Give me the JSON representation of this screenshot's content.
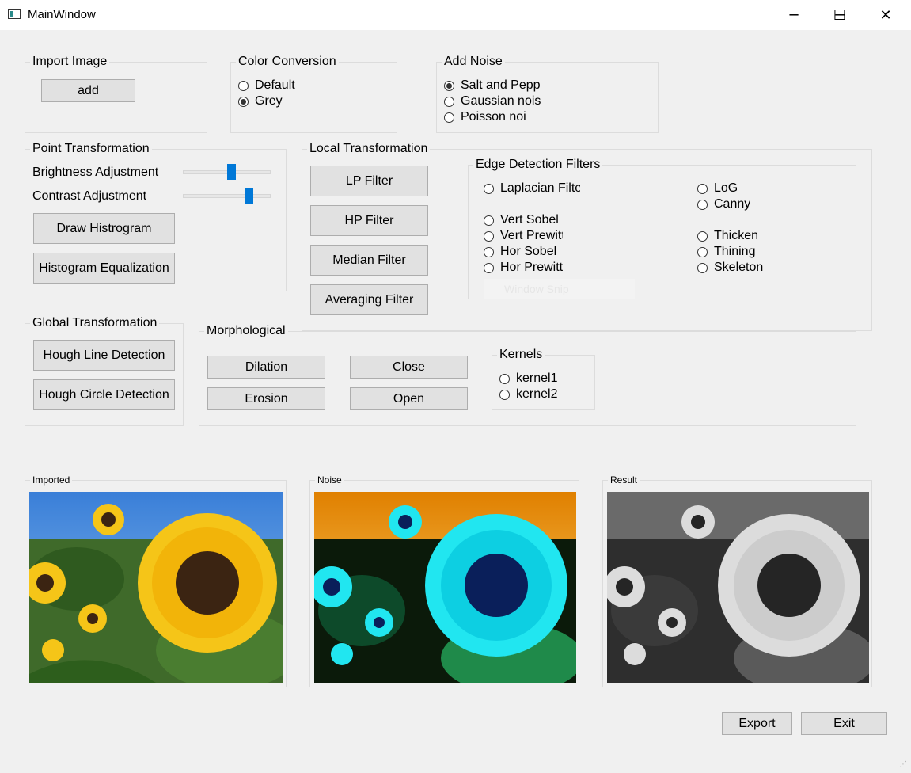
{
  "window": {
    "title": "MainWindow",
    "minimize_glyph": "─",
    "maximize_glyph": "☐",
    "close_glyph": "✕"
  },
  "import": {
    "title": "Import Image",
    "add_label": "add"
  },
  "color": {
    "title": "Color Conversion",
    "options": [
      "Default",
      "Grey"
    ],
    "selected": "Grey"
  },
  "noise": {
    "title": "Add Noise",
    "options": [
      "Salt and Pepper",
      "Gaussian noise",
      "Poisson noise"
    ],
    "selected": "Salt and Pepper"
  },
  "point": {
    "title": "Point Transformation",
    "brightness_label": "Brightness Adjustment",
    "brightness_value": 0.55,
    "contrast_label": "Contrast Adjustment",
    "contrast_value": 0.75,
    "draw_histogram": "Draw Histrogram",
    "hist_eq": "Histogram Equalization"
  },
  "local": {
    "title": "Local Transformation",
    "buttons": [
      "LP Filter",
      "HP Filter",
      "Median Filter",
      "Averaging Filter"
    ]
  },
  "edge": {
    "title": "Edge Detection Filters",
    "left": [
      "Laplacian Filter",
      "Vert Sobel",
      "Vert Prewitt",
      "Hor Sobel",
      "Hor Prewitt"
    ],
    "right": [
      "LoG",
      "Canny",
      "Thicken",
      "Thining",
      "Skeleton"
    ],
    "ghost": "Window Snip"
  },
  "global": {
    "title": "Global Transformation",
    "line": "Hough Line Detection",
    "circle": "Hough Circle Detection"
  },
  "morph": {
    "title": "Morphological",
    "dilation": "Dilation",
    "erosion": "Erosion",
    "close": "Close",
    "open": "Open",
    "kernels_title": "Kernels",
    "kernels": [
      "kernel1",
      "kernel2"
    ]
  },
  "images": {
    "imported": "Imported",
    "noise": "Noise",
    "result": "Result"
  },
  "footer": {
    "export": "Export",
    "exit": "Exit"
  },
  "colors": {
    "accent": "#0078d7",
    "button_bg": "#e1e1e1",
    "window_bg": "#f0f0f0"
  }
}
